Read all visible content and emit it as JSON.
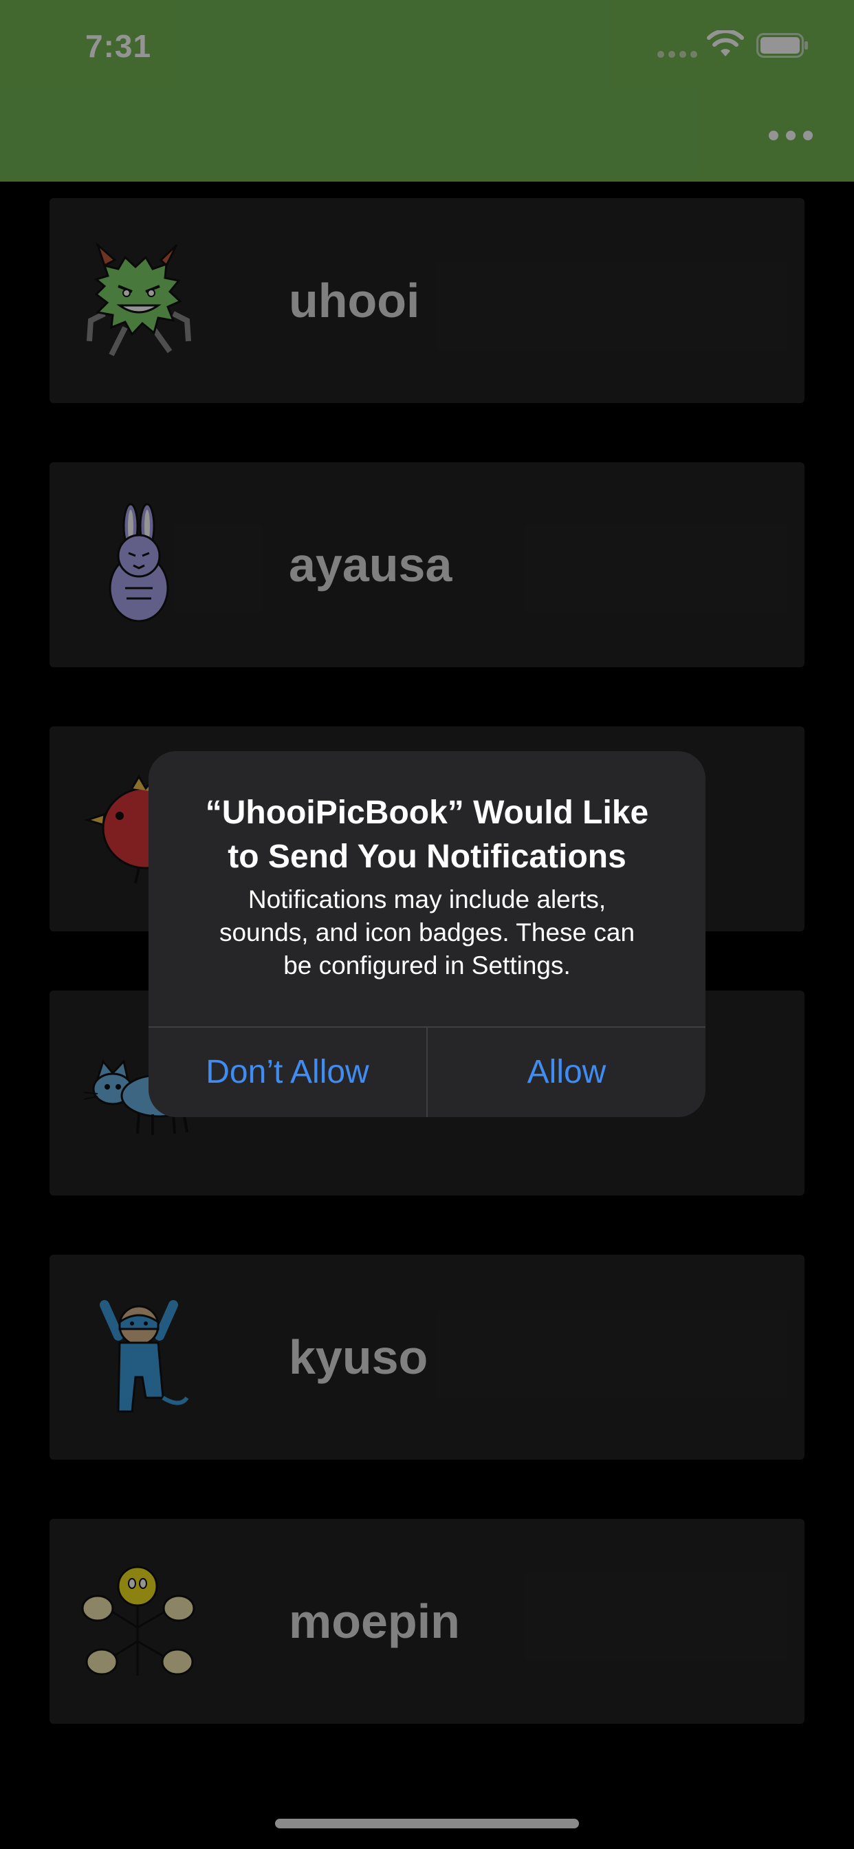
{
  "colors": {
    "navbar": "#72b454",
    "background": "#000000",
    "card": "#222222",
    "alert_background": "#262628",
    "alert_button": "#3f8cf3"
  },
  "status_bar": {
    "time": "7:31",
    "icons": [
      "cellular-signal-icon",
      "wifi-icon",
      "battery-icon"
    ]
  },
  "navbar": {
    "menu_icon": "ellipsis-icon"
  },
  "characters": [
    {
      "name": "uhooi",
      "icon": "green-spiky-monster-icon"
    },
    {
      "name": "ayausa",
      "icon": "purple-rabbit-icon"
    },
    {
      "name": "",
      "icon": "red-bird-icon"
    },
    {
      "name": "",
      "icon": "blue-cat-icon"
    },
    {
      "name": "kyuso",
      "icon": "blue-mouse-icon"
    },
    {
      "name": "moepin",
      "icon": "yellow-flower-creature-icon"
    }
  ],
  "alert": {
    "title_line1": "“UhooiPicBook” Would Like",
    "title_line2": "to Send You Notifications",
    "message_line1": "Notifications may include alerts,",
    "message_line2": "sounds, and icon badges. These can",
    "message_line3": "be configured in Settings.",
    "dont_allow_label": "Don’t Allow",
    "allow_label": "Allow"
  }
}
